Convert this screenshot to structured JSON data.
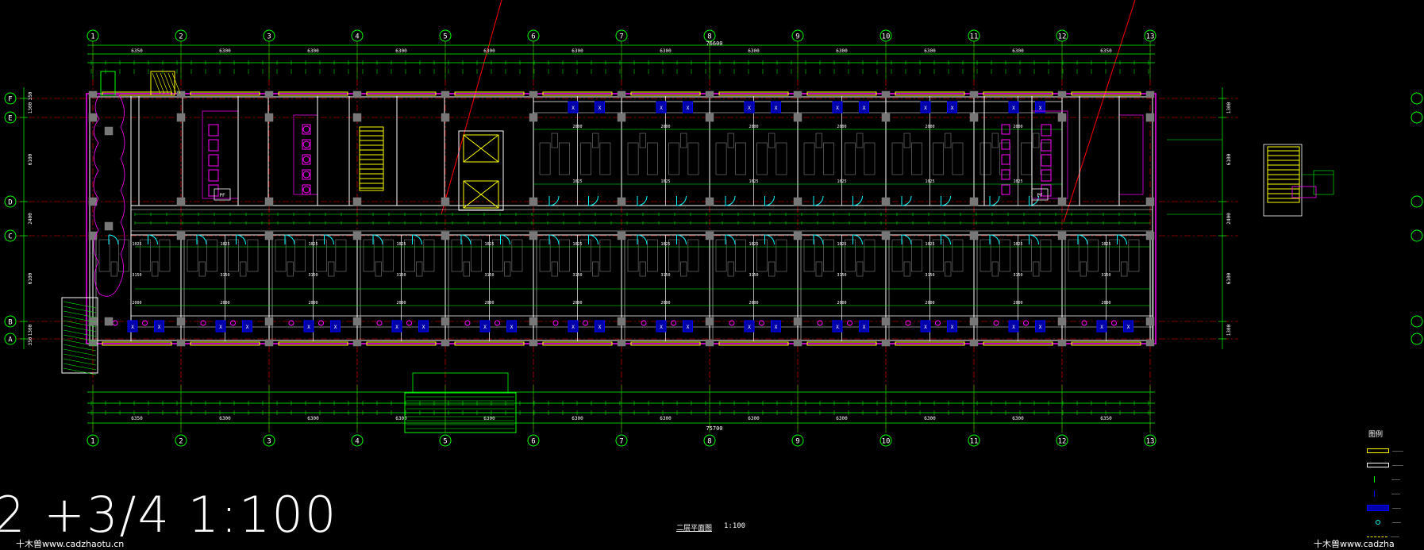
{
  "drawing": {
    "scale_label": "2 +3/4  1:100",
    "title": "二层平面图",
    "title_scale": "1:100",
    "watermark_left": "十木兽www.cadzhaotu.cn",
    "watermark_right": "十木兽www.cadzha",
    "overall_top": "76600",
    "overall_bottom": "75700",
    "legend_title": "图例",
    "axes_top": [
      "1",
      "2",
      "3",
      "4",
      "5",
      "6",
      "7",
      "8",
      "9",
      "10",
      "11",
      "12",
      "13"
    ],
    "axes_left": [
      "F",
      "E",
      "D",
      "C",
      "B",
      "A"
    ],
    "bay_dims": [
      "6350",
      "6300",
      "6300",
      "6300",
      "6300",
      "6300",
      "6300",
      "6300",
      "6300",
      "6300",
      "6300",
      "6350"
    ],
    "left_dims": [
      "350",
      "1300",
      "6100",
      "2400",
      "6100",
      "1300",
      "350"
    ],
    "right_dims": [
      "1300",
      "6100",
      "2400",
      "6100",
      "1300"
    ],
    "colors": {
      "background": "#000000",
      "grid_line": "#00ff00",
      "axis_red": "#ff0000",
      "wall": "#ffffff",
      "window": "#ffff00",
      "door": "#00ffff",
      "fixture": "#ff00ff",
      "column": "#808080",
      "blue": "#0000ff"
    }
  }
}
